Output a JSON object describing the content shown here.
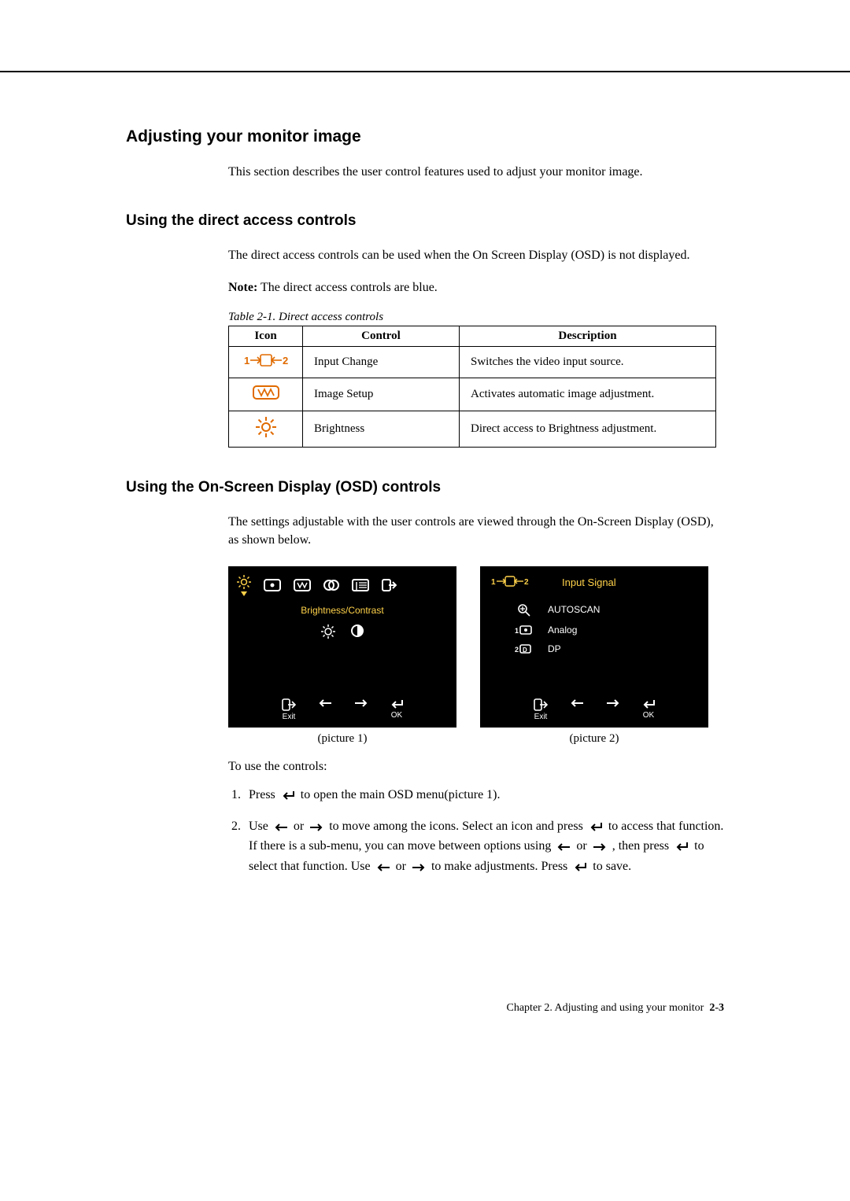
{
  "headings": {
    "h1": "Adjusting your monitor image",
    "h2": "Using the direct access controls",
    "h3": "Using the On-Screen Display (OSD) controls"
  },
  "p1": "This section describes the user control features used to adjust your monitor image.",
  "p2": "The direct access controls can be used when the On Screen Display (OSD) is not displayed.",
  "note_label": "Note:",
  "note_text": " The direct access controls are blue.",
  "table": {
    "caption": "Table 2-1. Direct access controls",
    "head": {
      "c1": "Icon",
      "c2": "Control",
      "c3": "Description"
    },
    "rows": [
      {
        "control": "Input Change",
        "desc": "Switches the video input source."
      },
      {
        "control": "Image Setup",
        "desc": "Activates automatic image adjustment."
      },
      {
        "control": "Brightness",
        "desc": "Direct access to Brightness adjustment."
      }
    ]
  },
  "p3": "The settings adjustable with the user controls are viewed through the On-Screen Display (OSD), as shown below.",
  "osd1": {
    "tab_title": "Brightness/Contrast",
    "footer": {
      "exit": "Exit",
      "ok": "OK"
    },
    "caption": "(picture 1)"
  },
  "osd2": {
    "tab_title": "Input Signal",
    "opt1": "AUTOSCAN",
    "opt2": "Analog",
    "opt3": "DP",
    "footer": {
      "exit": "Exit",
      "ok": "OK"
    },
    "caption": "(picture 2)"
  },
  "instr_intro": "To use the controls:",
  "step1_a": "Press ",
  "step1_b": " to open the main OSD menu(picture 1).",
  "step2_a": "Use ",
  "step2_b": " or ",
  "step2_c": " to move among the icons. Select an icon and press ",
  "step2_d": " to access that function. If there is a sub-menu, you can move between options using ",
  "step2_e": " or ",
  "step2_f": " , then press ",
  "step2_g": " to select that function. Use ",
  "step2_h": " or ",
  "step2_i": " to make adjustments. Press ",
  "step2_j": " to save.",
  "footer": {
    "chapter": "Chapter 2. Adjusting and using your monitor",
    "page": "2-3"
  },
  "chart_data": null
}
